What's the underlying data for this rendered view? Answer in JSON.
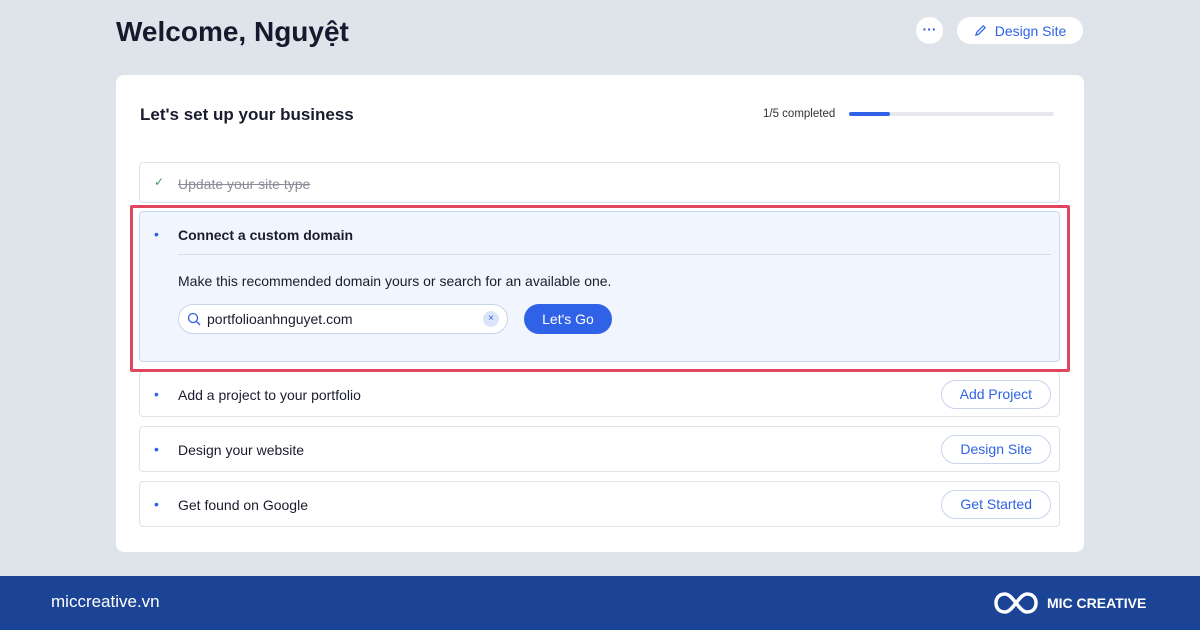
{
  "header": {
    "title": "Welcome, Nguyệt",
    "more_label": "···",
    "design_site_label": "Design Site",
    "pencil_icon": "pencil-icon"
  },
  "setup": {
    "title": "Let's set up your business",
    "progress_text": "1/5 completed",
    "progress_percent": 20,
    "items": [
      {
        "label": "Update your site type",
        "status": "completed"
      },
      {
        "label": "Connect a custom domain",
        "status": "expanded",
        "description": "Make this recommended domain yours or search for an available one.",
        "domain_value": "portfolioanhnguyet.com",
        "clear_label": "×",
        "action": "Let's Go"
      },
      {
        "label": "Add a project to your portfolio",
        "action": "Add Project"
      },
      {
        "label": "Design your website",
        "action": "Design Site"
      },
      {
        "label": "Get found on Google",
        "action": "Get Started"
      }
    ]
  },
  "footer": {
    "site": "miccreative.vn",
    "brand": "MIC CREATIVE"
  },
  "colors": {
    "accent": "#2f62e6",
    "highlight": "#e0475f",
    "footer": "#1c4496"
  }
}
